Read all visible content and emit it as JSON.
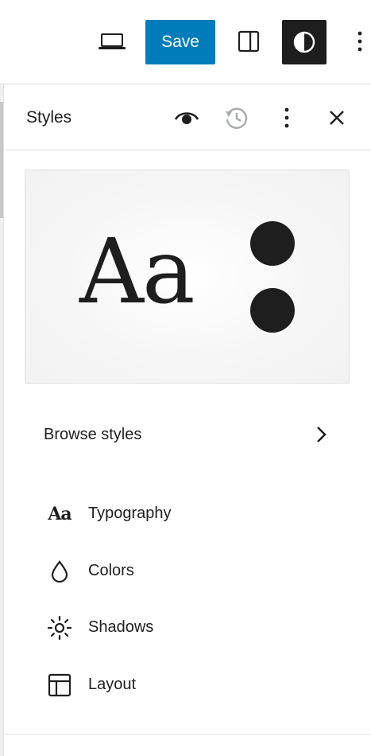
{
  "toolbar": {
    "save_label": "Save",
    "device_icon": "laptop-icon",
    "settings_icon": "sidebar-toggle-icon",
    "styles_icon": "contrast-icon",
    "options_icon": "vertical-ellipsis-icon"
  },
  "panel": {
    "title": "Styles",
    "header_icons": [
      "eye-icon",
      "revisions-icon",
      "vertical-ellipsis-icon",
      "close-icon"
    ],
    "preview": {
      "sample_text": "Aa",
      "text_color": "#1e1e1e",
      "dot_color": "#1e1e1e"
    },
    "browse_label": "Browse styles",
    "menu": [
      {
        "label": "Typography",
        "icon": "typography-icon",
        "glyph": "Aa"
      },
      {
        "label": "Colors",
        "icon": "droplet-icon"
      },
      {
        "label": "Shadows",
        "icon": "sun-icon"
      },
      {
        "label": "Layout",
        "icon": "layout-icon"
      }
    ]
  },
  "colors": {
    "accent": "#007cba",
    "dark": "#1e1e1e",
    "border": "#e0e0e0",
    "muted_icon": "#a7aaad"
  }
}
